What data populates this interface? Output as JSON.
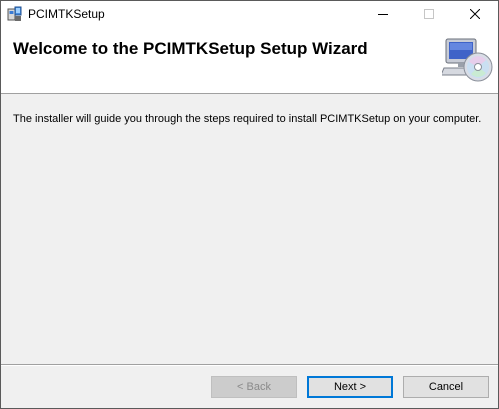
{
  "window": {
    "title": "PCIMTKSetup",
    "app_icon": "installer-icon",
    "controls": {
      "minimize": "minimize-icon",
      "maximize": "maximize-icon",
      "close": "close-icon"
    }
  },
  "header": {
    "heading": "Welcome to the PCIMTKSetup Setup Wizard",
    "icon": "computer-cd-icon"
  },
  "body": {
    "description": "The installer will guide you through the steps required to install PCIMTKSetup on your computer."
  },
  "buttons": {
    "back_label": "< Back",
    "next_label": "Next >",
    "cancel_label": "Cancel"
  },
  "colors": {
    "accent": "#0078d7",
    "window_bg": "#f0f0f0"
  }
}
